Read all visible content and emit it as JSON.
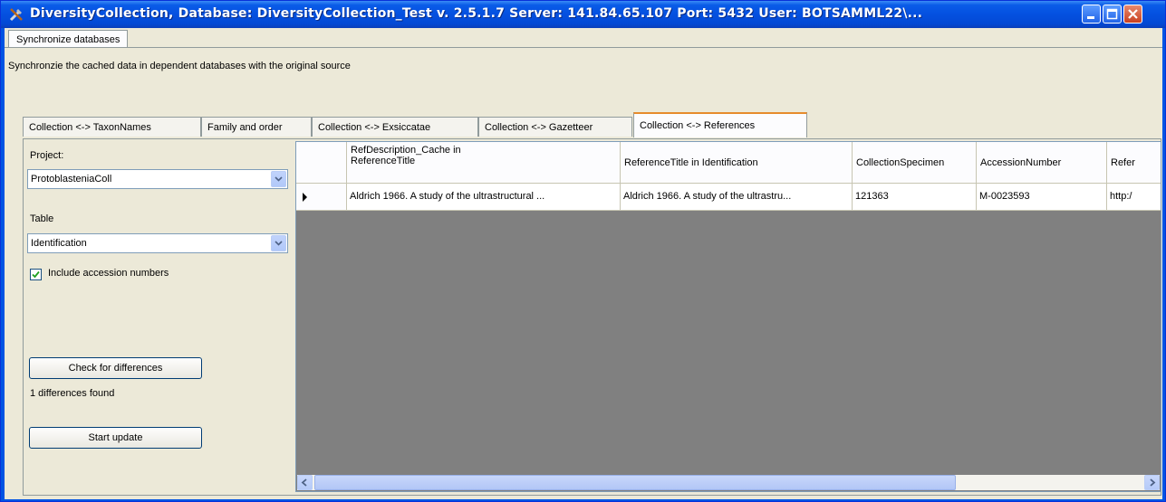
{
  "window": {
    "title": "DiversityCollection,  Database: DiversityCollection_Test   v. 2.5.1.7   Server: 141.84.65.107   Port: 5432   User: BOTSAMML22\\...",
    "app_icon": "tools-icon",
    "controls": [
      "minimize-icon",
      "maximize-icon",
      "close-icon"
    ]
  },
  "top_tab": {
    "label": "Synchronize databases"
  },
  "description": "Synchronzie the cached data in dependent databases with the original source",
  "tabs": [
    {
      "label": "Collection <-> TaxonNames"
    },
    {
      "label": "Family and order"
    },
    {
      "label": "Collection <-> Exsiccatae"
    },
    {
      "label": "Collection <-> Gazetteer"
    },
    {
      "label": "Collection <-> References",
      "active": true
    }
  ],
  "left_panel": {
    "project_label": "Project:",
    "project_value": "ProtoblasteniaColl",
    "table_label": "Table",
    "table_value": "Identification",
    "include_accession": {
      "label": "Include accession numbers",
      "checked": true
    },
    "check_button": "Check for differences",
    "status": "1 differences found",
    "start_button": "Start update"
  },
  "grid": {
    "columns": [
      "",
      "RefDescription_Cache in ReferenceTitle",
      "ReferenceTitle in Identification",
      "CollectionSpecimen",
      "AccessionNumber",
      "Refer"
    ],
    "rows": [
      {
        "indicator": "current-row-arrow-icon",
        "cells": [
          "Aldrich 1966. A study of the ultrastructural ...",
          "Aldrich 1966. A study of the ultrastru...",
          "121363",
          "M-0023593",
          "http:/"
        ]
      }
    ]
  },
  "colors": {
    "titlebar": "#0054e3",
    "face": "#ece9d8",
    "grid_bg": "#808080",
    "active_tab_accent": "#e68b2c"
  }
}
